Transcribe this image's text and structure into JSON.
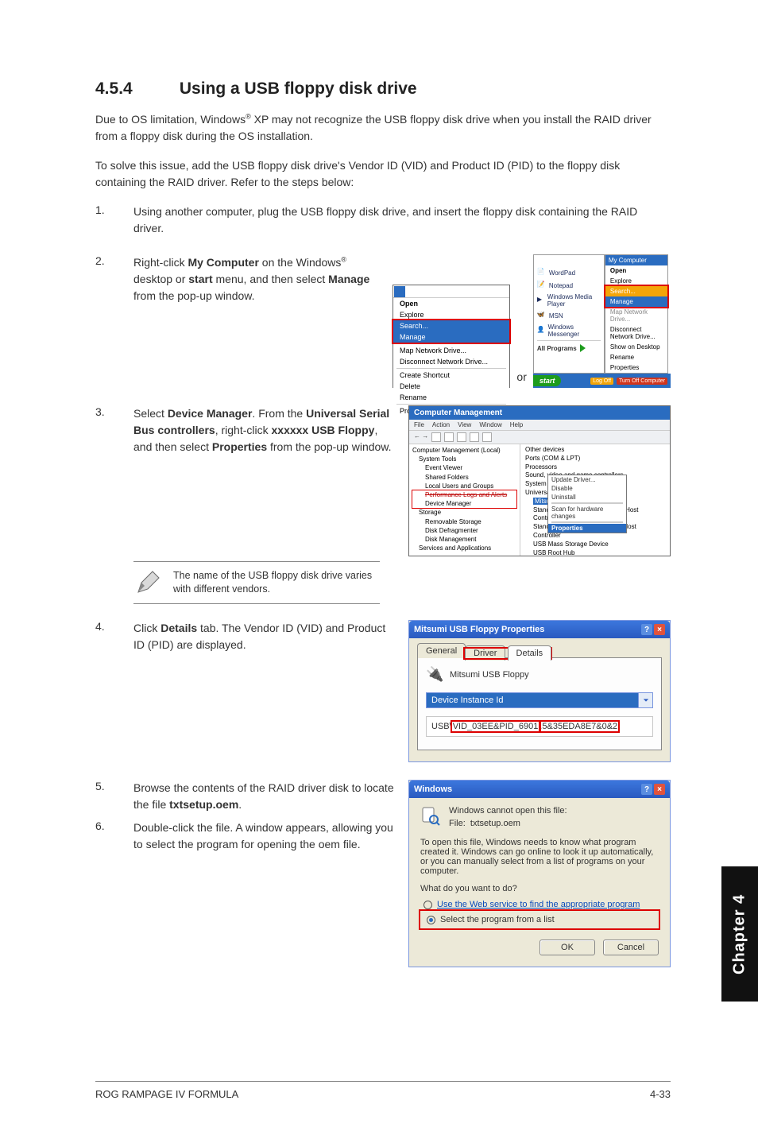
{
  "section": {
    "number": "4.5.4",
    "title": "Using a USB floppy disk drive"
  },
  "intro1_a": "Due to OS limitation, Windows",
  "intro1_sup": "®",
  "intro1_b": " XP may not recognize the USB floppy disk drive when you install the RAID driver from a floppy disk during the OS installation.",
  "intro2": "To solve this issue, add the USB floppy disk drive's Vendor ID (VID) and Product ID (PID) to the floppy disk containing the RAID driver. Refer to the steps below:",
  "steps": {
    "s1": {
      "num": "1.",
      "text": "Using another computer, plug the USB floppy disk drive, and insert the floppy disk containing the RAID driver."
    },
    "s2": {
      "num": "2.",
      "a": "Right-click ",
      "b": "My Computer",
      "c": " on the Windows",
      "sup": "®",
      "d": " desktop or ",
      "e": "start",
      "f": " menu, and then select ",
      "g": "Manage",
      "h": " from the pop-up window."
    },
    "s3": {
      "num": "3.",
      "a": "Select ",
      "b": "Device Manager",
      "c": ". From the ",
      "d": "Universal Serial Bus controllers",
      "e": ", right-click ",
      "f": "xxxxxx USB Floppy",
      "g": ", and then select ",
      "h": "Properties",
      "i": " from the pop-up window."
    },
    "s4": {
      "num": "4.",
      "a": "Click ",
      "b": "Details",
      "c": " tab. The Vendor ID (VID) and Product ID (PID) are displayed."
    },
    "s5": {
      "num": "5.",
      "a": "Browse the contents of the RAID driver disk to locate the file ",
      "b": "txtsetup.oem",
      "c": "."
    },
    "s6": {
      "num": "6.",
      "text": "Double-click the file. A window appears, allowing you to select the program for opening the oem file."
    }
  },
  "note": "The name of the USB floppy disk drive varies with different vendors.",
  "or_label": "or",
  "fig2_left": {
    "open": "Open",
    "explore": "Explore",
    "search": "Search...",
    "manage": "Manage",
    "map": "Map Network Drive...",
    "disc": "Disconnect Network Drive...",
    "shortcut": "Create Shortcut",
    "delete": "Delete",
    "rename": "Rename",
    "props": "Properties"
  },
  "fig2_r1": {
    "wordpad": "WordPad",
    "notepad": "Notepad",
    "wmp": "Windows Media Player",
    "msn": "MSN",
    "wmsg": "Windows Messenger",
    "allprog": "All Programs"
  },
  "fig2_r2": {
    "mycomp": "My Computer",
    "open": "Open",
    "explore": "Explore",
    "search": "Search...",
    "manage": "Manage",
    "mapnet": "Map Network Drive...",
    "discnet": "Disconnect Network Drive...",
    "showdesk": "Show on Desktop",
    "rename": "Rename",
    "props": "Properties"
  },
  "fig2_bar": {
    "start": "start",
    "logoff": "Log Off",
    "turnoff": "Turn Off Computer"
  },
  "fig3": {
    "title": "Computer Management",
    "menus": {
      "file": "File",
      "action": "Action",
      "view": "View",
      "window": "Window",
      "help": "Help"
    },
    "tree": {
      "root": "Computer Management (Local)",
      "systools": "System Tools",
      "eventv": "Event Viewer",
      "shared": "Shared Folders",
      "localu": "Local Users and Groups",
      "perf": "Performance Logs and Alerts",
      "devmgr": "Device Manager",
      "storage": "Storage",
      "remstore": "Removable Storage",
      "defrag": "Disk Defragmenter",
      "diskmg": "Disk Management",
      "services": "Services and Applications"
    },
    "right": {
      "other": "Other devices",
      "ports": "Ports (COM & LPT)",
      "procs": "Processors",
      "sound": "Sound, video and game controllers",
      "system": "System devices",
      "usb": "Universal Serial Bus controllers",
      "mitsumi": "Mitsumi USB Floppy",
      "stEnh": "Standard Enhanced PCI to USB Host Controller",
      "stUniv": "Standard Universal PCI to USB Host Controller",
      "mass": "USB Mass Storage Device",
      "root": "USB Root Hub"
    },
    "ctx": {
      "update": "Update Driver...",
      "disable": "Disable",
      "uninstall": "Uninstall",
      "scan": "Scan for hardware changes",
      "props": "Properties"
    }
  },
  "fig4": {
    "title": "Mitsumi USB Floppy Properties",
    "tabs": {
      "general": "General",
      "driver": "Driver",
      "details": "Details"
    },
    "devname": "Mitsumi USB Floppy",
    "combo": "Device Instance Id",
    "inst_pre": "USB\\",
    "inst_vid": "VID_03EE&PID_6901",
    "inst_mid": "\\",
    "inst_sn": "5&35EDA8E7&0&2"
  },
  "fig5": {
    "title": "Windows",
    "cannot": "Windows cannot open this file:",
    "file_lbl": "File:",
    "file_name": "txtsetup.oem",
    "msg": "To open this file, Windows needs to know what program created it.  Windows can go online to look it up automatically, or you can manually select from a list of programs on your computer.",
    "q": "What do you want to do?",
    "r1": "Use the Web service to find the appropriate program",
    "r2": "Select the program from a list",
    "ok": "OK",
    "cancel": "Cancel"
  },
  "side_tab": "Chapter 4",
  "footer": {
    "left": "ROG RAMPAGE IV FORMULA",
    "right": "4-33"
  }
}
